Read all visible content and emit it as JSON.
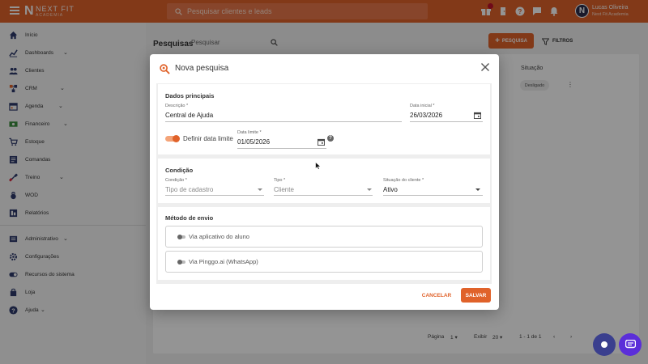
{
  "topbar": {
    "logo_mark": "N",
    "logo_text": "NEXT FIT",
    "logo_sub": "ACADEMIA",
    "search_placeholder": "Pesquisar clientes e leads",
    "user_initial": "N",
    "user_name": "Lucas Oliveira",
    "user_org": "Next Fit Academia",
    "icons": [
      "gift-icon",
      "door-icon",
      "help-icon",
      "chat-icon",
      "bell-icon"
    ]
  },
  "sidebar": {
    "items": [
      {
        "label": "Início",
        "icon": "home-icon",
        "chevron": false
      },
      {
        "label": "Dashboards",
        "icon": "chart-icon",
        "chevron": true
      },
      {
        "label": "Clientes",
        "icon": "people-icon",
        "chevron": false
      },
      {
        "label": "CRM",
        "icon": "crm-icon",
        "chevron": true
      },
      {
        "label": "Agenda",
        "icon": "calendar-icon",
        "chevron": true
      },
      {
        "label": "Financeiro",
        "icon": "money-icon",
        "chevron": true
      },
      {
        "label": "Estoque",
        "icon": "cart-icon",
        "chevron": false
      },
      {
        "label": "Comandas",
        "icon": "receipt-icon",
        "chevron": false
      },
      {
        "label": "Treino",
        "icon": "dumbbell-icon",
        "chevron": true
      },
      {
        "label": "WOD",
        "icon": "kettlebell-icon",
        "chevron": false
      },
      {
        "label": "Relatórios",
        "icon": "report-icon",
        "chevron": false
      },
      {
        "label": "Administrativo",
        "icon": "admin-icon",
        "chevron": true
      },
      {
        "label": "Configurações",
        "icon": "gear-icon",
        "chevron": false
      },
      {
        "label": "Recursos do sistema",
        "icon": "toggle-icon",
        "chevron": false
      },
      {
        "label": "Loja",
        "icon": "shop-icon",
        "chevron": false
      },
      {
        "label": "Ajuda",
        "icon": "help-icon",
        "chevron": true
      }
    ]
  },
  "main": {
    "title": "Pesquisas",
    "search_placeholder": "Pesquisar",
    "add_label": "PESQUISA",
    "filter_label": "FILTROS",
    "column_situacao": "Situação",
    "row_status": "Desligado",
    "pager": {
      "page_label": "Página",
      "page_value": "1",
      "show_label": "Exibir",
      "show_value": "20",
      "range": "1 - 1 de 1"
    }
  },
  "modal": {
    "title": "Nova pesquisa",
    "dados": {
      "title": "Dados principais",
      "descricao_label": "Descrição *",
      "descricao_value": "Central de Ajuda",
      "data_inicial_label": "Data inicial *",
      "data_inicial_value": "26/03/2026",
      "definir_limite_label": "Definir data limite",
      "definir_limite_on": true,
      "data_limite_label": "Data limite *",
      "data_limite_value": "01/05/2026"
    },
    "condicao": {
      "title": "Condição",
      "condicao_label": "Condição *",
      "condicao_value": "Tipo de cadastro",
      "tipo_label": "Tipo *",
      "tipo_value": "Cliente",
      "situacao_label": "Situação do cliente *",
      "situacao_value": "Ativo"
    },
    "metodo": {
      "title": "Método de envio",
      "options": [
        "Via aplicativo do aluno",
        "Via Pinggo.ai (WhatsApp)"
      ]
    },
    "cancel_label": "CANCELAR",
    "save_label": "SALVAR"
  },
  "colors": {
    "brand": "#e0622a",
    "fab_primary": "#3a3f8e",
    "fab_chat": "#5b2ed9"
  }
}
